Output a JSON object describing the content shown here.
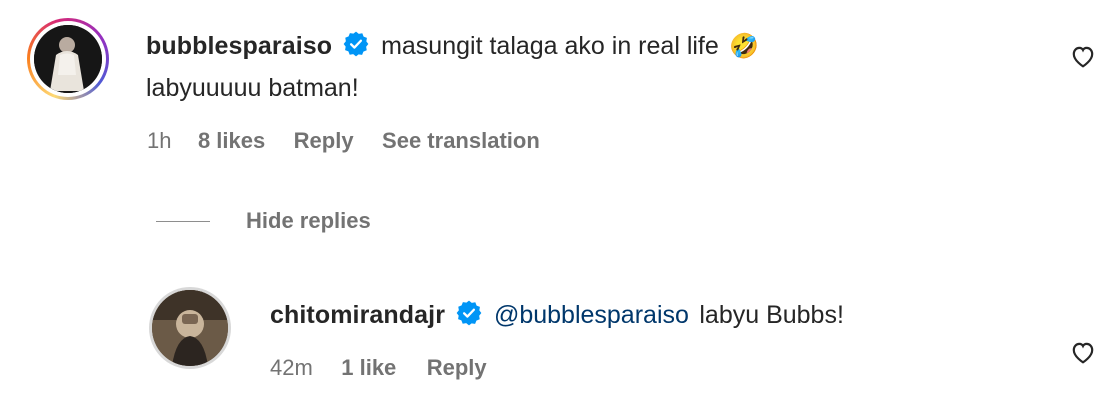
{
  "comment": {
    "username": "bubblesparaiso",
    "text_line1": "masungit talaga ako in real life",
    "emoji": "🤣",
    "text_line2": "labyuuuuu batman!",
    "time": "1h",
    "likes": "8 likes",
    "reply_label": "Reply",
    "translate_label": "See translation"
  },
  "replies_toggle": {
    "label": "Hide replies"
  },
  "reply": {
    "username": "chitomirandajr",
    "mention": "@bubblesparaiso",
    "text": "labyu Bubbs!",
    "time": "42m",
    "likes": "1 like",
    "reply_label": "Reply"
  },
  "colors": {
    "text": "#262626",
    "meta": "#737373",
    "mention": "#00376b",
    "verified": "#0095f6"
  }
}
